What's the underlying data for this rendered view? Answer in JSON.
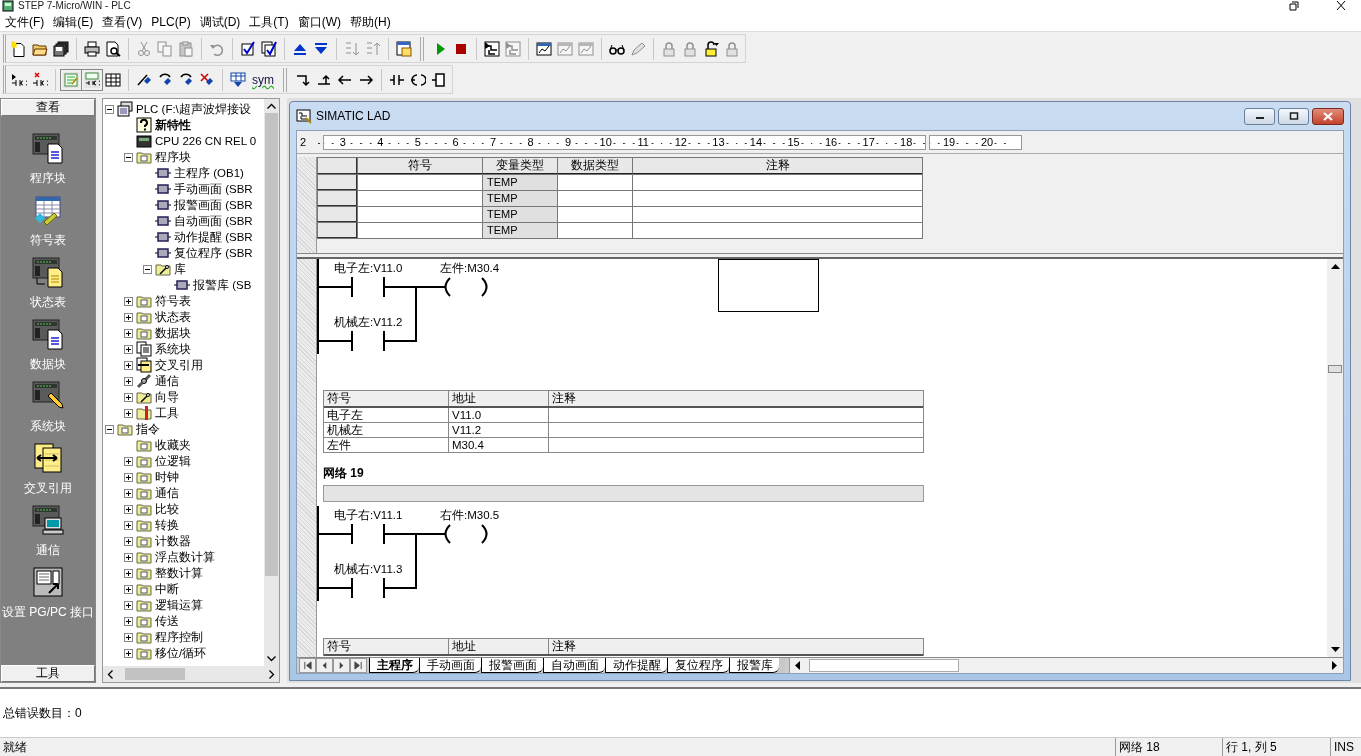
{
  "window": {
    "title": "STEP 7-Micro/WIN - PLC"
  },
  "menu": [
    "文件(F)",
    "编辑(E)",
    "查看(V)",
    "PLC(P)",
    "调试(D)",
    "工具(T)",
    "窗口(W)",
    "帮助(H)"
  ],
  "toolbars": [
    [
      {
        "kind": "new",
        "disabled": false
      },
      {
        "kind": "open",
        "disabled": false
      },
      {
        "kind": "saveall",
        "disabled": false
      },
      {
        "kind": "sep"
      },
      {
        "kind": "print",
        "disabled": false
      },
      {
        "kind": "preview",
        "disabled": false
      },
      {
        "kind": "sep"
      },
      {
        "kind": "cut",
        "disabled": true
      },
      {
        "kind": "copy",
        "disabled": true
      },
      {
        "kind": "paste",
        "disabled": true
      },
      {
        "kind": "sep"
      },
      {
        "kind": "undo",
        "disabled": true
      },
      {
        "kind": "sep"
      },
      {
        "kind": "compile",
        "disabled": false
      },
      {
        "kind": "compileall",
        "disabled": false
      },
      {
        "kind": "sep"
      },
      {
        "kind": "upload",
        "disabled": false
      },
      {
        "kind": "download",
        "disabled": false
      },
      {
        "kind": "sep"
      },
      {
        "kind": "sortup",
        "disabled": true
      },
      {
        "kind": "sortdown",
        "disabled": true
      },
      {
        "kind": "sep"
      },
      {
        "kind": "options",
        "disabled": false
      },
      {
        "kind": "grip"
      },
      {
        "kind": "run",
        "disabled": false
      },
      {
        "kind": "stop",
        "disabled": false
      },
      {
        "kind": "sep"
      },
      {
        "kind": "monitor",
        "disabled": false
      },
      {
        "kind": "monitor",
        "disabled": true
      },
      {
        "kind": "sep"
      },
      {
        "kind": "trend",
        "disabled": false
      },
      {
        "kind": "trend",
        "disabled": true
      },
      {
        "kind": "trend",
        "disabled": true
      },
      {
        "kind": "sep"
      },
      {
        "kind": "glasses",
        "disabled": false
      },
      {
        "kind": "pen",
        "disabled": true
      },
      {
        "kind": "sep"
      },
      {
        "kind": "lock",
        "disabled": true
      },
      {
        "kind": "lock",
        "disabled": true
      },
      {
        "kind": "unlock",
        "disabled": false
      },
      {
        "kind": "lock",
        "disabled": true
      }
    ],
    [
      {
        "kind": "insertcontact",
        "disabled": false
      },
      {
        "kind": "deletecontact",
        "disabled": false
      },
      {
        "kind": "sep"
      },
      {
        "kind": "viewlad",
        "disabled": false,
        "selected": true
      },
      {
        "kind": "viewboth",
        "disabled": false,
        "selected": true
      },
      {
        "kind": "viewgrid",
        "disabled": false,
        "selected": false
      },
      {
        "kind": "sep"
      },
      {
        "kind": "marker",
        "disabled": false
      },
      {
        "kind": "markernext",
        "disabled": false
      },
      {
        "kind": "markerprev",
        "disabled": false
      },
      {
        "kind": "markerdel",
        "disabled": false
      },
      {
        "kind": "sep"
      },
      {
        "kind": "tableinsert",
        "disabled": false
      },
      {
        "kind": "text",
        "label": "sym",
        "disabled": false
      },
      {
        "kind": "grip"
      },
      {
        "kind": "wiredown",
        "disabled": false
      },
      {
        "kind": "wireup",
        "disabled": false
      },
      {
        "kind": "wireleft",
        "disabled": false
      },
      {
        "kind": "wireright",
        "disabled": false
      },
      {
        "kind": "sep"
      },
      {
        "kind": "contact",
        "disabled": false
      },
      {
        "kind": "coil",
        "disabled": false
      },
      {
        "kind": "box",
        "disabled": false
      }
    ]
  ],
  "navigation_bar": {
    "header": "查看",
    "items": [
      {
        "label": "程序块",
        "kind": "program"
      },
      {
        "label": "符号表",
        "kind": "symbols"
      },
      {
        "label": "状态表",
        "kind": "status"
      },
      {
        "label": "数据块",
        "kind": "data"
      },
      {
        "label": "系统块",
        "kind": "system"
      },
      {
        "label": "交叉引用",
        "kind": "crossref"
      },
      {
        "label": "通信",
        "kind": "comm"
      },
      {
        "label": "设置 PG/PC 接口",
        "kind": "setpg"
      }
    ],
    "footer": "工具"
  },
  "tree": [
    {
      "label": "PLC (F:\\超声波焊接设",
      "kind": "plc",
      "expanded": true,
      "children": [
        {
          "label": "新特性",
          "kind": "help"
        },
        {
          "label": "CPU 226 CN REL 0",
          "kind": "cpu"
        },
        {
          "label": "程序块",
          "kind": "folder",
          "expanded": true,
          "children": [
            {
              "label": "主程序 (OB1)",
              "kind": "block"
            },
            {
              "label": "手动画面 (SBR",
              "kind": "block"
            },
            {
              "label": "报警画面 (SBR",
              "kind": "block"
            },
            {
              "label": "自动画面 (SBR",
              "kind": "block"
            },
            {
              "label": "动作提醒 (SBR",
              "kind": "block"
            },
            {
              "label": "复位程序 (SBR",
              "kind": "block"
            },
            {
              "label": "库",
              "kind": "library",
              "expanded": true,
              "children": [
                {
                  "label": "报警库 (SB",
                  "kind": "block"
                }
              ]
            }
          ]
        },
        {
          "label": "符号表",
          "kind": "folder",
          "expanded": false
        },
        {
          "label": "状态表",
          "kind": "folder",
          "expanded": false
        },
        {
          "label": "数据块",
          "kind": "folder",
          "expanded": false
        },
        {
          "label": "系统块",
          "kind": "docs",
          "expanded": false
        },
        {
          "label": "交叉引用",
          "kind": "crossref",
          "expanded": false
        },
        {
          "label": "通信",
          "kind": "comm",
          "expanded": false
        },
        {
          "label": "向导",
          "kind": "library",
          "expanded": false
        },
        {
          "label": "工具",
          "kind": "tools",
          "expanded": false
        }
      ]
    },
    {
      "label": "指令",
      "kind": "folder",
      "expanded": true,
      "children": [
        {
          "label": "收藏夹",
          "kind": "folder"
        },
        {
          "label": "位逻辑",
          "kind": "folder",
          "expanded": false
        },
        {
          "label": "时钟",
          "kind": "folder",
          "expanded": false
        },
        {
          "label": "通信",
          "kind": "folder",
          "expanded": false
        },
        {
          "label": "比较",
          "kind": "folder",
          "expanded": false
        },
        {
          "label": "转换",
          "kind": "folder",
          "expanded": false
        },
        {
          "label": "计数器",
          "kind": "folder",
          "expanded": false
        },
        {
          "label": "浮点数计算",
          "kind": "folder",
          "expanded": false
        },
        {
          "label": "整数计算",
          "kind": "folder",
          "expanded": false
        },
        {
          "label": "中断",
          "kind": "folder",
          "expanded": false
        },
        {
          "label": "逻辑运算",
          "kind": "folder",
          "expanded": false
        },
        {
          "label": "传送",
          "kind": "folder",
          "expanded": false
        },
        {
          "label": "程序控制",
          "kind": "folder",
          "expanded": false
        },
        {
          "label": "移位/循环",
          "kind": "folder",
          "expanded": false
        }
      ]
    }
  ],
  "editor": {
    "title": "SIMATIC LAD",
    "ruler": [
      [
        "2"
      ],
      [
        "3",
        "4",
        "5",
        "6",
        "7",
        "8",
        "9",
        "10",
        "11",
        "12",
        "13",
        "14",
        "15",
        "16",
        "17",
        "18"
      ],
      [
        "19",
        "20"
      ]
    ],
    "variable_table": {
      "columns": [
        "符号",
        "变量类型",
        "数据类型",
        "注释"
      ],
      "rows": [
        {
          "var_type": "TEMP"
        },
        {
          "var_type": "TEMP"
        },
        {
          "var_type": "TEMP"
        },
        {
          "var_type": "TEMP"
        }
      ]
    },
    "networks": [
      {
        "empty_box": true,
        "contacts": [
          "电子左:V11.0",
          "机械左:V11.2"
        ],
        "coil": "左件:M30.4",
        "symbols": {
          "columns": [
            "符号",
            "地址",
            "注释"
          ],
          "rows": [
            {
              "symbol": "电子左",
              "address": "V11.0"
            },
            {
              "symbol": "机械左",
              "address": "V11.2"
            },
            {
              "symbol": "左件",
              "address": "M30.4"
            }
          ]
        }
      },
      {
        "title": "网络 19",
        "contacts": [
          "电子右:V11.1",
          "机械右:V11.3"
        ],
        "coil": "右件:M30.5",
        "symbols": {
          "columns": [
            "符号",
            "地址",
            "注释"
          ]
        }
      }
    ],
    "tabs": [
      {
        "label": "主程序",
        "selected": true
      },
      {
        "label": "手动画面",
        "selected": false
      },
      {
        "label": "报警画面",
        "selected": false
      },
      {
        "label": "自动画面",
        "selected": false
      },
      {
        "label": "动作提醒",
        "selected": false
      },
      {
        "label": "复位程序",
        "selected": false
      },
      {
        "label": "报警库",
        "selected": false
      }
    ]
  },
  "output": {
    "text": "总错误数目：0"
  },
  "status_bar": [
    "就绪",
    "网络 18",
    "行 1, 列 5",
    "INS"
  ]
}
